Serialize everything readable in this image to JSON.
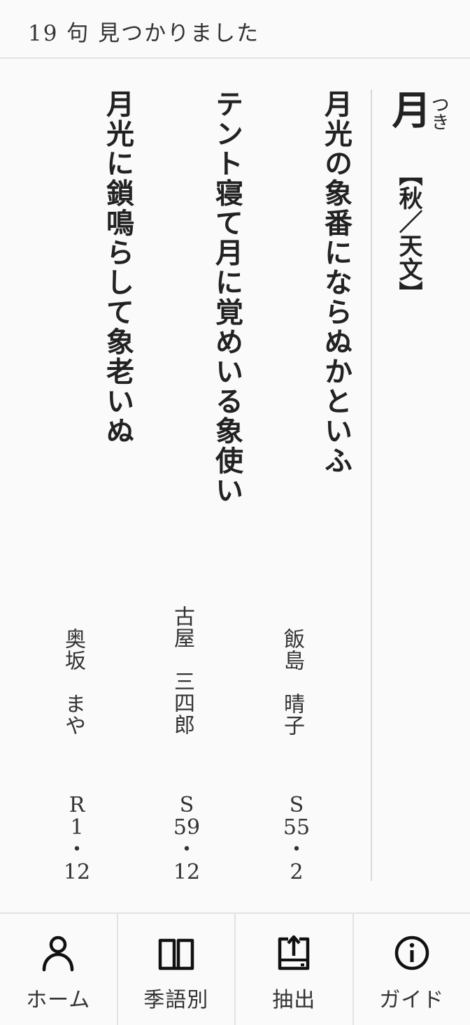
{
  "header": {
    "count_text": "19 句 見つかりました"
  },
  "kigo": {
    "word": "月",
    "reading": "つき",
    "season": "【秋／天文】"
  },
  "entries": [
    {
      "haiku": "月光の象番にならぬかといふ",
      "author": "飯島　晴子",
      "era": "S",
      "year": "55",
      "sep": "・",
      "month": "2"
    },
    {
      "haiku": "テント寝て月に覚めいる象使い",
      "author": "古屋　三四郎",
      "era": "S",
      "year": "59",
      "sep": "・",
      "month": "12"
    },
    {
      "haiku": "月光に鎖鳴らして象老いぬ",
      "author": "奥坂　まや",
      "era": "R",
      "year": "1",
      "sep": "・",
      "month": "12"
    }
  ],
  "nav": {
    "items": [
      {
        "label": "ホーム",
        "icon": "person-icon"
      },
      {
        "label": "季語別",
        "icon": "book-icon"
      },
      {
        "label": "抽出",
        "icon": "export-icon"
      },
      {
        "label": "ガイド",
        "icon": "info-icon"
      }
    ]
  }
}
